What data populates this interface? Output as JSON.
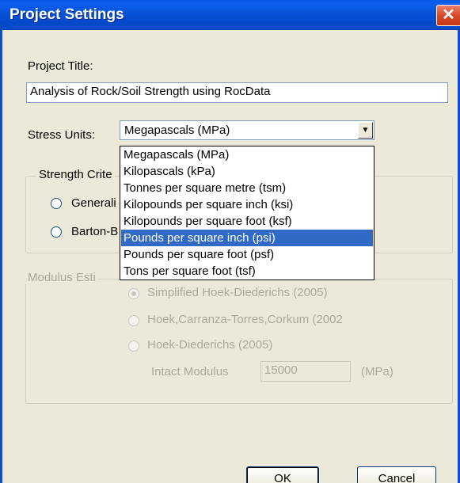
{
  "window": {
    "title": "Project Settings",
    "close_glyph": "✕"
  },
  "project_title": {
    "label": "Project Title:",
    "value": "Analysis of Rock/Soil Strength using RocData"
  },
  "stress_units": {
    "label": "Stress Units:",
    "selected": "Megapascals (MPa)",
    "options": [
      "Megapascals (MPa)",
      "Kilopascals (kPa)",
      "Tonnes per square metre (tsm)",
      "Kilopounds per square inch (ksi)",
      "Kilopounds per square foot (ksf)",
      "Pounds per square inch (psi)",
      "Pounds per square foot (psf)",
      "Tons per square foot (tsf)"
    ],
    "highlighted_option": "Pounds per square inch (psi)"
  },
  "strength_criterion": {
    "legend": "Strength Crite",
    "options": [
      "Generali",
      "Barton-B"
    ]
  },
  "modulus": {
    "legend": "Modulus Esti",
    "options": [
      "Simplified Hoek-Diederichs (2005)",
      "Hoek,Carranza-Torres,Corkum (2002",
      "Hoek-Diederichs (2005)"
    ],
    "selected_option": "Simplified Hoek-Diederichs (2005)",
    "intact_label": "Intact Modulus",
    "intact_value": "15000",
    "intact_unit": "(MPa)"
  },
  "buttons": {
    "ok": "OK",
    "cancel": "Cancel"
  },
  "colors": {
    "titlebar": "#0753d8",
    "highlight": "#316ac5",
    "dialog_bg": "#ece9d8"
  }
}
